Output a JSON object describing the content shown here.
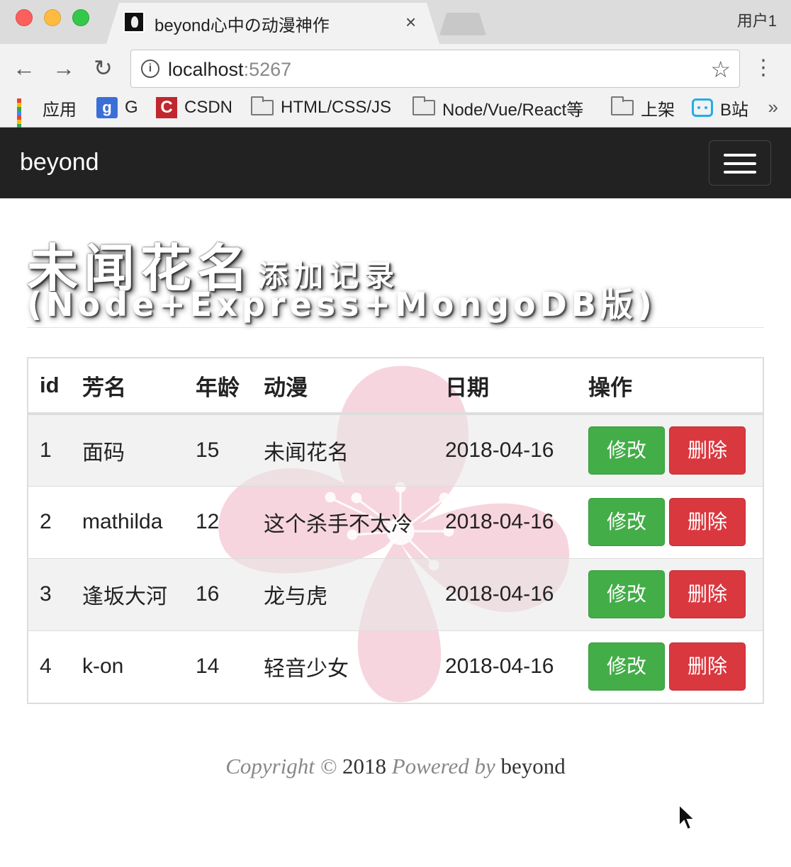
{
  "browser": {
    "tab_title": "beyond心中の动漫神作",
    "tab_close": "×",
    "profile": "用户1",
    "url_host": "localhost",
    "url_port": ":5267",
    "bookmarks": [
      "应用",
      "G",
      "CSDN",
      "HTML/CSS/JS",
      "Node/Vue/React等",
      "上架",
      "B站"
    ],
    "bookmarks_more": "»"
  },
  "navbar": {
    "brand": "beyond"
  },
  "heading": {
    "main": "未闻花名",
    "sub": "添加记录",
    "second": "(Node+Express+MongoDB版)"
  },
  "table": {
    "headers": [
      "id",
      "芳名",
      "年龄",
      "动漫",
      "日期",
      "操作"
    ],
    "edit_label": "修改",
    "delete_label": "删除",
    "rows": [
      {
        "id": "1",
        "name": "面码",
        "age": "15",
        "anime": "未闻花名",
        "date": "2018-04-16"
      },
      {
        "id": "2",
        "name": "mathilda",
        "age": "12",
        "anime": "这个杀手不太冷",
        "date": "2018-04-16"
      },
      {
        "id": "3",
        "name": "逢坂大河",
        "age": "16",
        "anime": "龙与虎",
        "date": "2018-04-16"
      },
      {
        "id": "4",
        "name": "k-on",
        "age": "14",
        "anime": "轻音少女",
        "date": "2018-04-16"
      }
    ]
  },
  "footer": {
    "copyright": "Copyright ©",
    "year": "2018",
    "powered_by": "Powered by",
    "author": "beyond"
  },
  "colors": {
    "navbar_bg": "#222222",
    "edit_button": "#43ad47",
    "delete_button": "#d9383f",
    "blossom": "#f7d3dd"
  }
}
